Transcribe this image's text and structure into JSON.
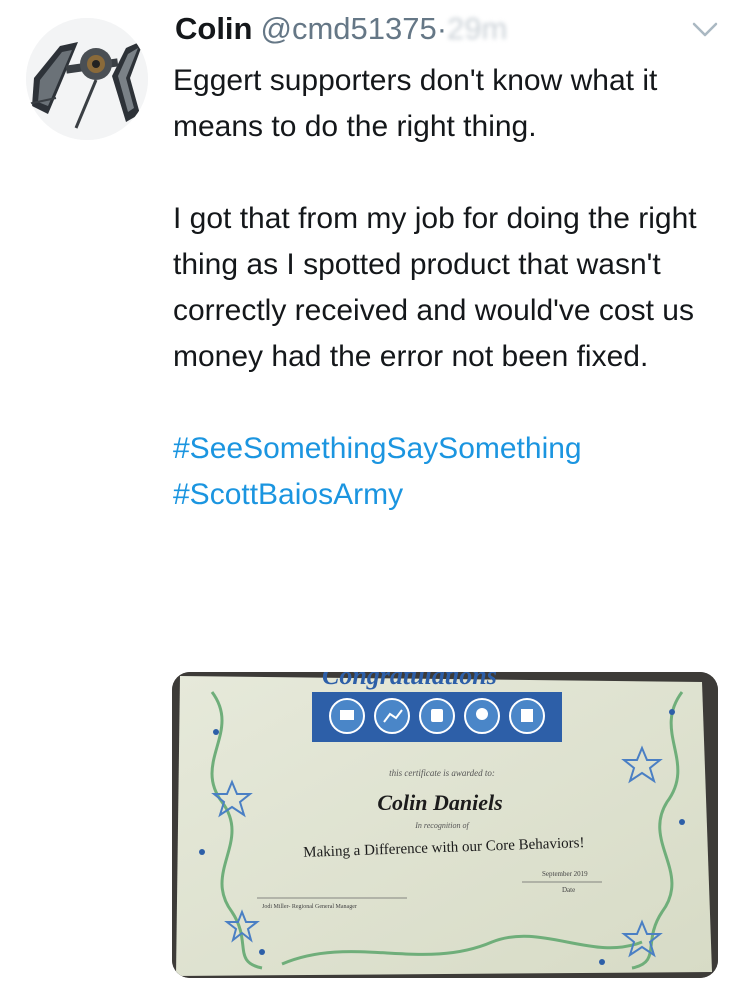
{
  "tweet": {
    "author_name": "Colin",
    "author_handle": "@cmd51375",
    "separator": "·",
    "timestamp": "29m",
    "text_paragraph_1": "Eggert supporters don't know what it means to do the right thing.",
    "text_paragraph_2": "I got that from my job for doing the right thing as I spotted product that wasn't correctly received and would've cost us money had the error not been fixed.",
    "hashtags": [
      "#SeeSomethingSaySomething",
      "#ScottBaiosArmy"
    ],
    "icons": {
      "avatar": "tie-fighter-avatar",
      "menu": "chevron-down-icon"
    }
  },
  "certificate": {
    "heading_partial": "Congratulations",
    "awarded_text": "this certificate is awarded to:",
    "recipient": "Colin Daniels",
    "recognition_text": "In recognition of",
    "reason": "Making a Difference with our Core Behaviors!",
    "date_value": "September 2019",
    "date_label": "Date",
    "signature_line": "Jodi Miller- Regional General Manager",
    "badge_colors": {
      "bar": "#2d5fa8",
      "badge": "#4a86c8"
    }
  },
  "colors": {
    "hashtag": "#1b95e0",
    "handle": "#657786",
    "text": "#14171a"
  }
}
